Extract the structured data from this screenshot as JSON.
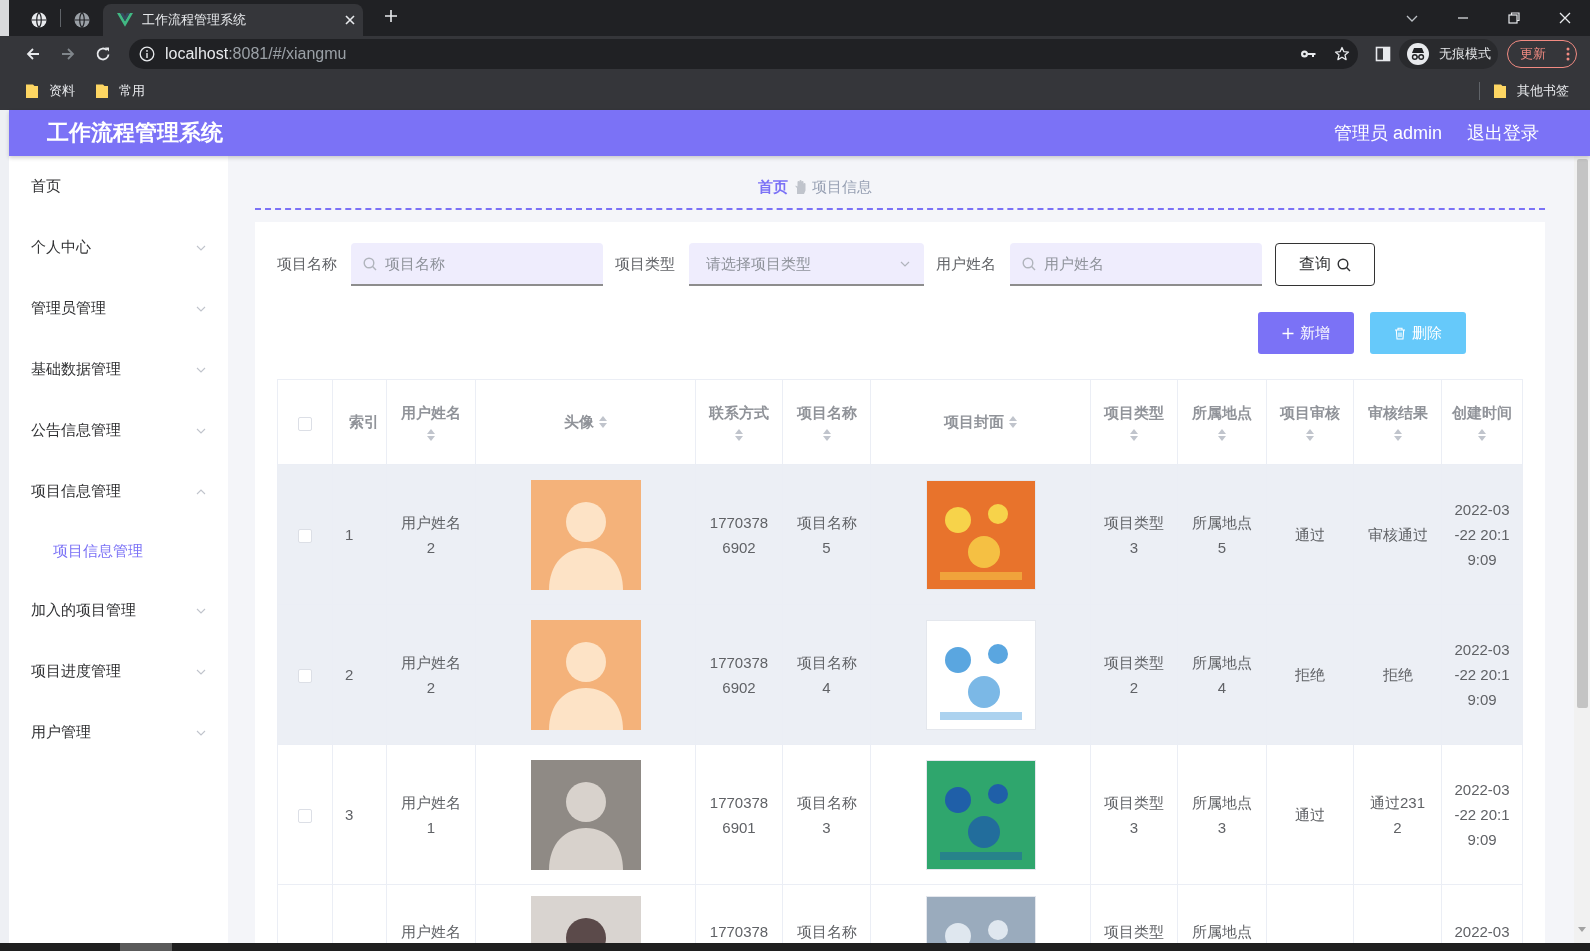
{
  "browser": {
    "tabs": [
      {
        "kind": "pinned",
        "selected": false
      },
      {
        "kind": "pinned",
        "selected": false
      },
      {
        "kind": "page",
        "title": "工作流程管理系统",
        "selected": true
      }
    ],
    "address": {
      "host": "localhost",
      "rest": ":8081/#/xiangmu"
    },
    "profile": "无痕模式",
    "update": "更新",
    "bookmarks": [
      {
        "label": "资料"
      },
      {
        "label": "常用"
      }
    ],
    "other_bookmarks": "其他书签"
  },
  "header": {
    "title": "工作流程管理系统",
    "user": "管理员 admin",
    "logout": "退出登录"
  },
  "sidebar": {
    "items": [
      {
        "label": "首页",
        "selected": false
      },
      {
        "label": "个人中心",
        "selected": false,
        "expanded": false
      },
      {
        "label": "管理员管理",
        "selected": false,
        "expanded": false
      },
      {
        "label": "基础数据管理",
        "selected": false,
        "expanded": false
      },
      {
        "label": "公告信息管理",
        "selected": false,
        "expanded": false
      },
      {
        "label": "项目信息管理",
        "selected": false,
        "expanded": true,
        "children": [
          {
            "label": "项目信息管理",
            "selected": true
          }
        ]
      },
      {
        "label": "加入的项目管理",
        "selected": false,
        "expanded": false
      },
      {
        "label": "项目进度管理",
        "selected": false,
        "expanded": false
      },
      {
        "label": "用户管理",
        "selected": false,
        "expanded": false
      }
    ]
  },
  "breadcrumb": [
    {
      "kind": "link",
      "label": "首页"
    },
    {
      "kind": "current",
      "label": "项目信息"
    }
  ],
  "search": {
    "fields": [
      {
        "kind": "input",
        "label": "项目名称",
        "placeholder": "项目名称"
      },
      {
        "kind": "select",
        "label": "项目类型",
        "placeholder": "请选择项目类型"
      },
      {
        "kind": "input",
        "label": "用户姓名",
        "placeholder": "用户姓名"
      }
    ],
    "button": "查询"
  },
  "actions": [
    {
      "kind": "add",
      "label": "新增"
    },
    {
      "kind": "delete",
      "label": "删除"
    }
  ],
  "table": {
    "all_checked": false,
    "columns": [
      {
        "kind": "check"
      },
      {
        "kind": "text",
        "label": "索引",
        "sortable": false
      },
      {
        "kind": "text",
        "label": "用户姓名",
        "sortable": true
      },
      {
        "kind": "avatar",
        "label": "头像",
        "sortable": true
      },
      {
        "kind": "text",
        "label": "联系方式",
        "sortable": true
      },
      {
        "kind": "text",
        "label": "项目名称",
        "sortable": true
      },
      {
        "kind": "cover",
        "label": "项目封面",
        "sortable": true
      },
      {
        "kind": "text",
        "label": "项目类型",
        "sortable": true
      },
      {
        "kind": "text",
        "label": "所属地点",
        "sortable": true
      },
      {
        "kind": "text",
        "label": "项目审核",
        "sortable": true
      },
      {
        "kind": "text",
        "label": "审核结果",
        "sortable": true
      },
      {
        "kind": "text",
        "label": "创建时间",
        "sortable": true
      }
    ],
    "rows": [
      {
        "kind": "full",
        "checked": false,
        "highlighted": true,
        "cells": [
          "",
          "1",
          "用户姓名2",
          "",
          "17703786902",
          "项目名称5",
          "",
          "项目类型3",
          "所属地点5",
          "通过",
          "审核通过",
          "2022-03-22 20:19:09"
        ]
      },
      {
        "kind": "full",
        "checked": false,
        "highlighted": true,
        "cells": [
          "",
          "2",
          "用户姓名2",
          "",
          "17703786902",
          "项目名称4",
          "",
          "项目类型2",
          "所属地点4",
          "拒绝",
          "拒绝",
          "2022-03-22 20:19:09"
        ]
      },
      {
        "kind": "full",
        "checked": false,
        "highlighted": false,
        "cells": [
          "",
          "3",
          "用户姓名1",
          "",
          "17703786901",
          "项目名称3",
          "",
          "项目类型3",
          "所属地点3",
          "通过",
          "通过2312",
          "2022-03-22 20:19:09"
        ]
      },
      {
        "kind": "cut",
        "highlighted": false,
        "cells": [
          "",
          "",
          "用户姓名",
          "",
          "1770378",
          "项目名称",
          "",
          "项目类型",
          "所属地点",
          "",
          "",
          "2022-03"
        ]
      }
    ]
  }
}
